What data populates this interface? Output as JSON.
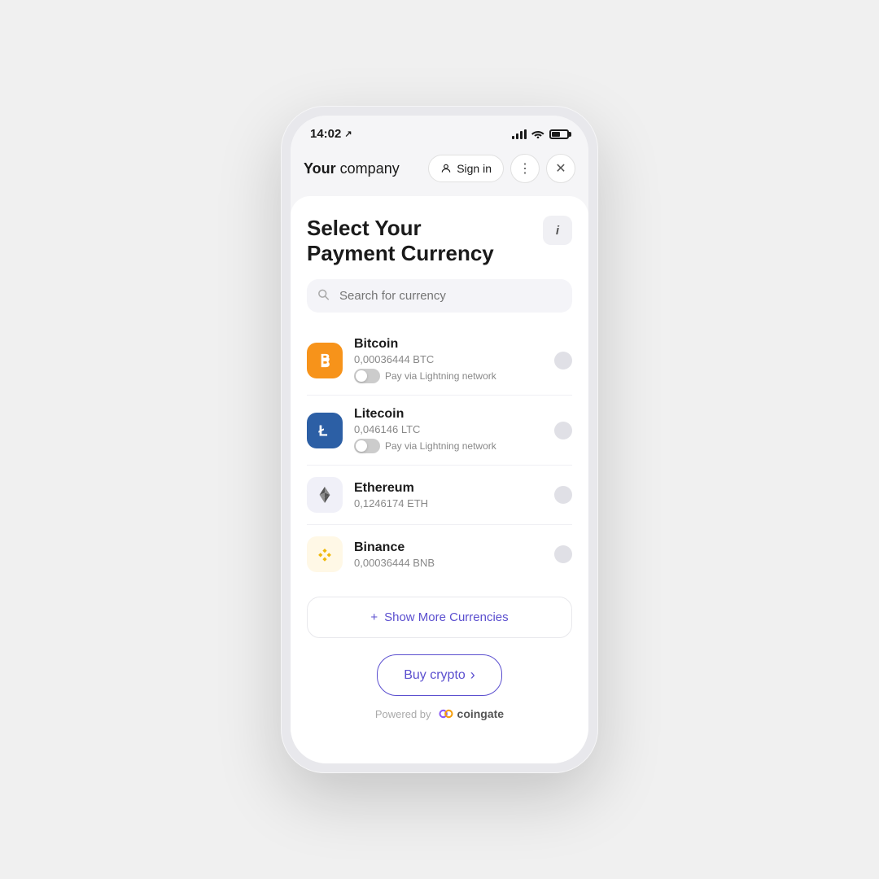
{
  "statusBar": {
    "time": "14:02",
    "navigation_icon": "↗"
  },
  "topNav": {
    "companyBold": "Your",
    "companyNormal": " company",
    "signInLabel": "Sign in",
    "moreLabel": "⋮",
    "closeLabel": "✕"
  },
  "page": {
    "title": "Select Your\nPayment Currency",
    "infoLabel": "i",
    "searchPlaceholder": "Search for currency"
  },
  "currencies": [
    {
      "name": "Bitcoin",
      "amount": "0,00036444 BTC",
      "hasLightning": true,
      "lightningLabel": "Pay via Lightning network",
      "symbol": "₿",
      "logoType": "btc"
    },
    {
      "name": "Litecoin",
      "amount": "0,046146 LTC",
      "hasLightning": true,
      "lightningLabel": "Pay via Lightning network",
      "symbol": "Ł",
      "logoType": "ltc"
    },
    {
      "name": "Ethereum",
      "amount": "0,1246174 ETH",
      "hasLightning": false,
      "symbol": "◆",
      "logoType": "eth"
    },
    {
      "name": "Binance",
      "amount": "0,00036444 BNB",
      "hasLightning": false,
      "symbol": "◈",
      "logoType": "bnb"
    }
  ],
  "showMore": {
    "label": "Show More Currencies",
    "icon": "+"
  },
  "buyButton": {
    "label": "Buy crypto",
    "arrow": "›"
  },
  "poweredBy": {
    "label": "Powered by",
    "brand": "coingate"
  }
}
